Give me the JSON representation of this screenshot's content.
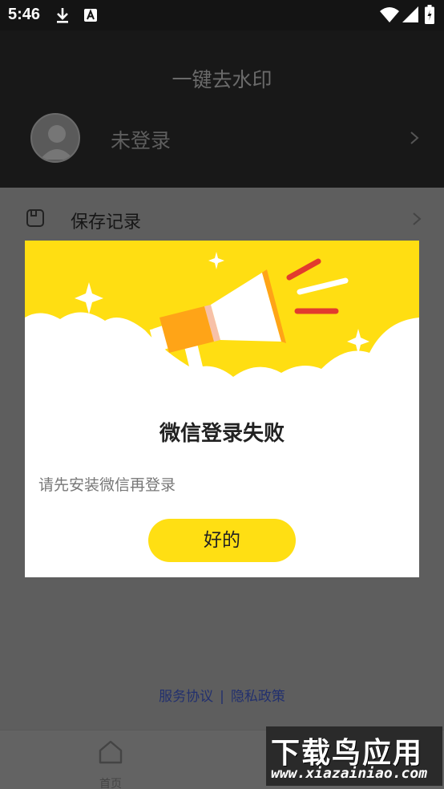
{
  "status_bar": {
    "time": "5:46",
    "icons": [
      "download-icon",
      "a-icon",
      "wifi-icon",
      "signal-icon",
      "battery-icon"
    ]
  },
  "header": {
    "title": "一键去水印",
    "login_status": "未登录"
  },
  "menu": {
    "items": [
      {
        "label": "保存记录",
        "icon": "save-icon"
      }
    ]
  },
  "footer": {
    "terms": "服务协议",
    "separator": "|",
    "privacy": "隐私政策"
  },
  "bottom_nav": {
    "home_label": "首页"
  },
  "dialog": {
    "title": "微信登录失败",
    "message": "请先安装微信再登录",
    "ok_label": "好的"
  },
  "watermark": {
    "top": "下载鸟应用",
    "bottom": "www.xiazainiao.com"
  },
  "colors": {
    "accent": "#ffdf13",
    "banner": "#ffde12",
    "overlay": "#5e5e5e"
  }
}
